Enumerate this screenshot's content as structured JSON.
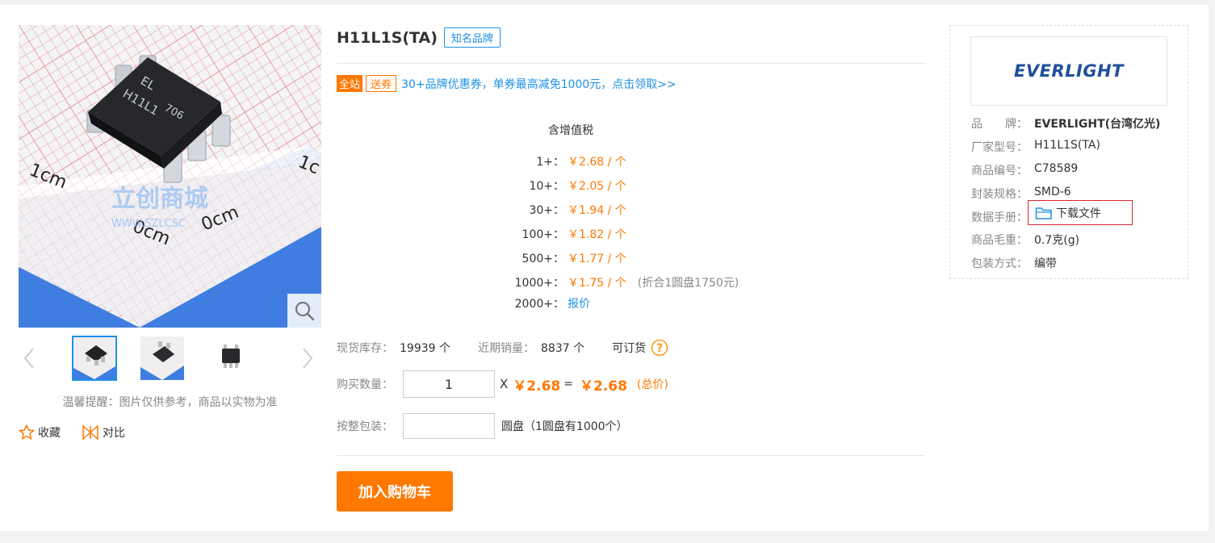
{
  "product": {
    "title": "H11L1S(TA)",
    "brand_tag": "知名品牌",
    "chip_marking": [
      "EL",
      "H11L1",
      "706"
    ],
    "ruler_labels": [
      "1cm",
      "0cm",
      "0cm",
      "1c"
    ],
    "watermark": "立创商城",
    "watermark_url": "WWW.SZLCSC"
  },
  "image_tip": "温馨提醒：图片仅供参考，商品以实物为准",
  "actions": {
    "favorite": "收藏",
    "compare": "对比"
  },
  "promo": {
    "tag_all": "全站",
    "tag_coupon": "送券",
    "text": "30+品牌优惠券，单券最高减免1000元，点击领取>>"
  },
  "pricing": {
    "header": "含增值税",
    "tiers": [
      {
        "qty": "1+：",
        "price": "￥2.68 / 个",
        "extra": ""
      },
      {
        "qty": "10+：",
        "price": "￥2.05 / 个",
        "extra": ""
      },
      {
        "qty": "30+：",
        "price": "￥1.94 / 个",
        "extra": ""
      },
      {
        "qty": "100+：",
        "price": "￥1.82 / 个",
        "extra": ""
      },
      {
        "qty": "500+：",
        "price": "￥1.77 / 个",
        "extra": ""
      },
      {
        "qty": "1000+：",
        "price": "￥1.75 / 个",
        "extra": "(折合1圆盘1750元)"
      }
    ],
    "quote_qty": "2000+：",
    "quote_link": "报价"
  },
  "stock": {
    "stock_label": "现货库存：",
    "stock_value": "19939 个",
    "sales_label": "近期销量：",
    "sales_value": "8837 个",
    "orderable": "可订货"
  },
  "purchase": {
    "qty_label": "购买数量：",
    "qty_value": "1",
    "times": "X",
    "unit_price": "￥2.68",
    "equals": "=",
    "total": "￥2.68",
    "total_label": "(总价)",
    "reel_label": "按整包装：",
    "reel_value": "",
    "reel_text": "圆盘（1圆盘有1000个）",
    "cart_button": "加入购物车"
  },
  "brand": {
    "logo_text": "EVERLIGHT",
    "specs": [
      {
        "label": "品　　牌：",
        "value": "EVERLIGHT(台湾亿光)"
      },
      {
        "label": "厂家型号：",
        "value": "H11L1S(TA)"
      },
      {
        "label": "商品编号：",
        "value": "C78589"
      },
      {
        "label": "封装规格：",
        "value": "SMD-6"
      },
      {
        "label": "数据手册：",
        "value": ""
      },
      {
        "label": "商品毛重：",
        "value": "0.7克(g)"
      },
      {
        "label": "包装方式：",
        "value": "编带"
      }
    ],
    "download_label": "下载文件"
  },
  "colors": {
    "accent": "#ff7800",
    "link": "#1e90e6",
    "highlight": "#d9262c"
  }
}
